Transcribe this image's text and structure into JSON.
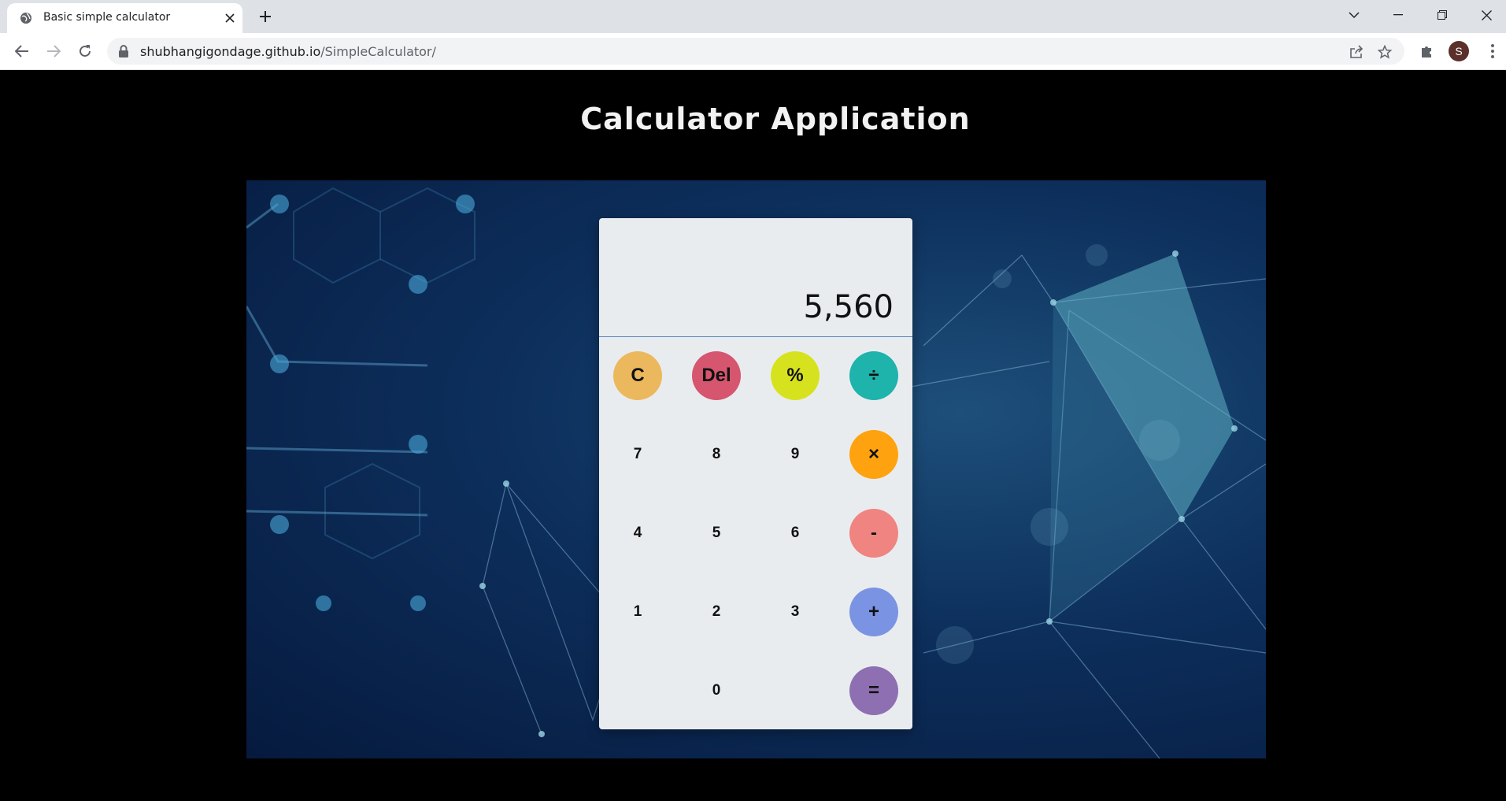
{
  "browser": {
    "tab_title": "Basic simple calculator",
    "url_host": "shubhangigondage.github.io",
    "url_path": "/SimpleCalculator/",
    "profile_initial": "S"
  },
  "page": {
    "heading": "Calculator Application"
  },
  "calculator": {
    "display": "5,560",
    "keys": {
      "clear": "C",
      "delete": "Del",
      "percent": "%",
      "divide": "÷",
      "seven": "7",
      "eight": "8",
      "nine": "9",
      "multiply": "×",
      "four": "4",
      "five": "5",
      "six": "6",
      "minus": "-",
      "one": "1",
      "two": "2",
      "three": "3",
      "plus": "+",
      "zero": "0",
      "equals": "="
    }
  },
  "colors": {
    "clear": "#ecb85e",
    "delete": "#d6556f",
    "percent": "#d7e21f",
    "divide": "#1eb3ab",
    "multiply": "#fea20f",
    "minus": "#f08481",
    "plus": "#7b93e3",
    "equals": "#8e6fb1"
  },
  "icons": {
    "favicon": "globe-icon",
    "lock": "lock-icon",
    "share": "share-icon",
    "bookmark": "star-icon",
    "extensions": "puzzle-icon"
  }
}
